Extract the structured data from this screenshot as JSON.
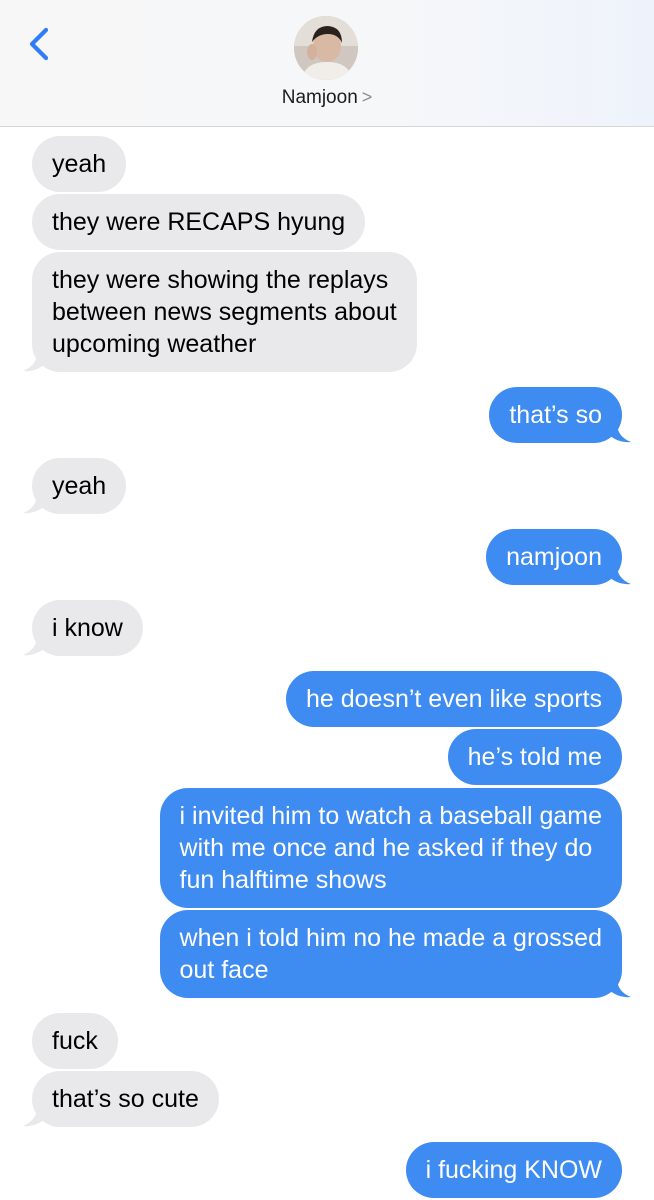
{
  "colors": {
    "incoming_bubble": "#e9e9eb",
    "outgoing_bubble": "#3e8bf1",
    "accent": "#2f7cf6"
  },
  "header": {
    "back_icon": "chevron-left-icon",
    "contact_name": "Namjoon",
    "contact_chevron": ">"
  },
  "messages": [
    {
      "from": "them",
      "lines": [
        "yeah"
      ]
    },
    {
      "from": "them",
      "lines": [
        "they were RECAPS hyung"
      ]
    },
    {
      "from": "them",
      "lines": [
        "they were showing the replays",
        "between news segments about",
        "upcoming weather"
      ]
    },
    {
      "from": "me",
      "lines": [
        "that’s so"
      ]
    },
    {
      "from": "them",
      "lines": [
        "yeah"
      ]
    },
    {
      "from": "me",
      "lines": [
        "namjoon"
      ]
    },
    {
      "from": "them",
      "lines": [
        "i know"
      ]
    },
    {
      "from": "me",
      "lines": [
        "he doesn’t even like sports"
      ]
    },
    {
      "from": "me",
      "lines": [
        "he’s told me"
      ]
    },
    {
      "from": "me",
      "lines": [
        "i invited him to watch a baseball game",
        "with me once and he asked if they do",
        "fun halftime shows"
      ]
    },
    {
      "from": "me",
      "lines": [
        "when i told him no he made a grossed",
        "out face"
      ]
    },
    {
      "from": "them",
      "lines": [
        "fuck"
      ]
    },
    {
      "from": "them",
      "lines": [
        "that’s so cute"
      ]
    },
    {
      "from": "me",
      "lines": [
        "i fucking KNOW"
      ]
    }
  ]
}
